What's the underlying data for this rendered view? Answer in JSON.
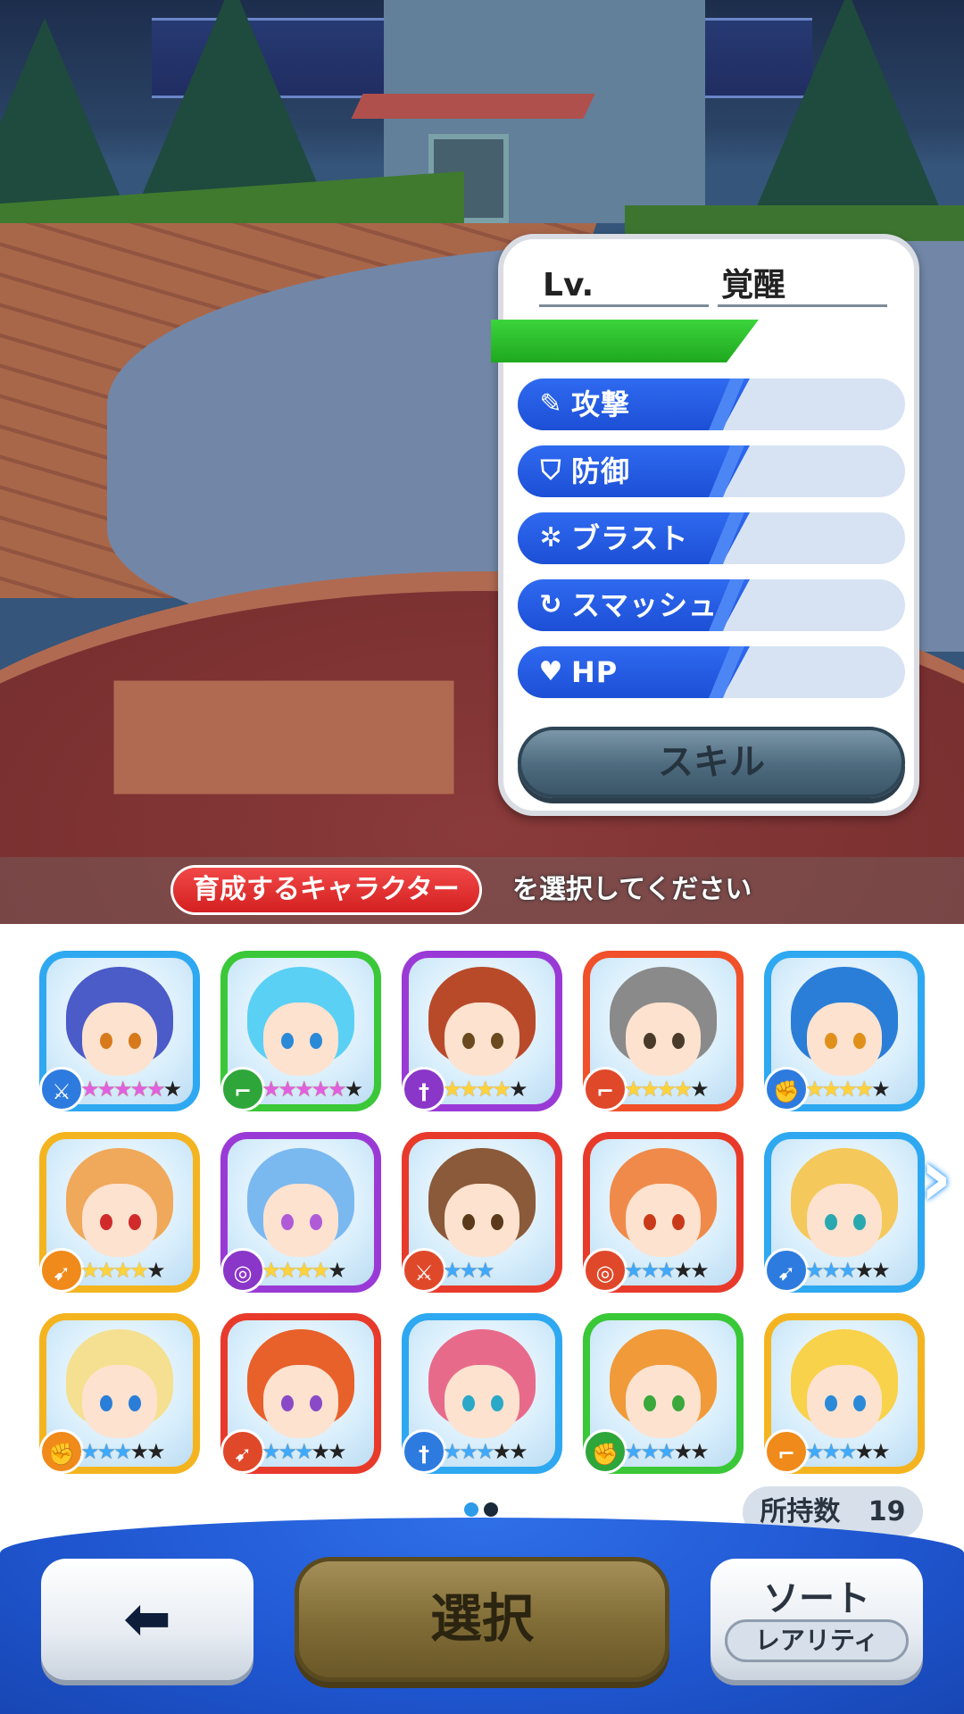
{
  "stats_panel": {
    "level_label": "Lv.",
    "awakening_label": "覚醒",
    "stats": [
      {
        "icon": "sword-icon",
        "glyph": "✎",
        "label": "攻撃"
      },
      {
        "icon": "shield-icon",
        "glyph": "⛉",
        "label": "防御"
      },
      {
        "icon": "burst-icon",
        "glyph": "✲",
        "label": "ブラスト"
      },
      {
        "icon": "smash-icon",
        "glyph": "↻",
        "label": "スマッシュ"
      },
      {
        "icon": "heart-icon",
        "glyph": "♥",
        "label": "HP"
      }
    ],
    "skill_button": "スキル"
  },
  "instruction": {
    "highlight": "育成するキャラクター",
    "text": "を選択してください"
  },
  "characters": [
    {
      "frame": "#2ea8f0",
      "hair": "#4b5bc8",
      "eye": "#d77a1c",
      "type_color": "#2e7be0",
      "type_icon": "sword-icon",
      "type_glyph": "⚔",
      "stars_on": 5,
      "stars_total": 6,
      "star_color": "pink"
    },
    {
      "frame": "#3ac838",
      "hair": "#5ad0f4",
      "eye": "#2a8ad8",
      "type_color": "#2fa63a",
      "type_icon": "gun-icon",
      "type_glyph": "⌐",
      "stars_on": 5,
      "stars_total": 6,
      "star_color": "pink"
    },
    {
      "frame": "#9a3ad6",
      "hair": "#b84a2a",
      "eye": "#6a4a1e",
      "type_color": "#8a36c8",
      "type_icon": "sword-icon",
      "type_glyph": "†",
      "stars_on": 4,
      "stars_total": 5,
      "star_color": "gold"
    },
    {
      "frame": "#f0502a",
      "hair": "#8a8a8a",
      "eye": "#4a3a2a",
      "type_color": "#e0482a",
      "type_icon": "gun-icon",
      "type_glyph": "⌐",
      "stars_on": 4,
      "stars_total": 5,
      "star_color": "gold"
    },
    {
      "frame": "#2ea8f0",
      "hair": "#2a7ed8",
      "eye": "#e0901a",
      "type_color": "#2e7be0",
      "type_icon": "fist-icon",
      "type_glyph": "✊",
      "stars_on": 4,
      "stars_total": 5,
      "star_color": "gold"
    },
    {
      "frame": "#f4b420",
      "hair": "#f0a85a",
      "eye": "#d02a2a",
      "type_color": "#f08a1a",
      "type_icon": "bow-icon",
      "type_glyph": "➹",
      "stars_on": 4,
      "stars_total": 5,
      "star_color": "gold"
    },
    {
      "frame": "#9a3ad6",
      "hair": "#7ab8f0",
      "eye": "#b05ad8",
      "type_color": "#8a36c8",
      "type_icon": "magic-icon",
      "type_glyph": "◎",
      "stars_on": 4,
      "stars_total": 5,
      "star_color": "gold"
    },
    {
      "frame": "#e83a2a",
      "hair": "#8a5a3a",
      "eye": "#5a3a1a",
      "type_color": "#e0482a",
      "type_icon": "sword-icon",
      "type_glyph": "⚔",
      "stars_on": 3,
      "stars_total": 3,
      "star_color": "blue"
    },
    {
      "frame": "#e83a2a",
      "hair": "#f08a4a",
      "eye": "#c83a1a",
      "type_color": "#e0482a",
      "type_icon": "magic-icon",
      "type_glyph": "◎",
      "stars_on": 3,
      "stars_total": 5,
      "star_color": "blue"
    },
    {
      "frame": "#2ea8f0",
      "hair": "#f4c85a",
      "eye": "#2aa8b0",
      "type_color": "#2e7be0",
      "type_icon": "bow-icon",
      "type_glyph": "➹",
      "stars_on": 3,
      "stars_total": 5,
      "star_color": "blue"
    },
    {
      "frame": "#f4b420",
      "hair": "#f4e090",
      "eye": "#2a7ed8",
      "type_color": "#f08a1a",
      "type_icon": "fist-icon",
      "type_glyph": "✊",
      "stars_on": 3,
      "stars_total": 5,
      "star_color": "blue"
    },
    {
      "frame": "#e83a2a",
      "hair": "#e8602a",
      "eye": "#8a4ac8",
      "type_color": "#e0482a",
      "type_icon": "bow-icon",
      "type_glyph": "➹",
      "stars_on": 3,
      "stars_total": 5,
      "star_color": "blue"
    },
    {
      "frame": "#2ea8f0",
      "hair": "#e86a8a",
      "eye": "#2aa8c8",
      "type_color": "#2e7be0",
      "type_icon": "sword-icon",
      "type_glyph": "†",
      "stars_on": 3,
      "stars_total": 5,
      "star_color": "blue"
    },
    {
      "frame": "#3ac838",
      "hair": "#f09a3a",
      "eye": "#3aa83a",
      "type_color": "#2fa63a",
      "type_icon": "fist-icon",
      "type_glyph": "✊",
      "stars_on": 3,
      "stars_total": 5,
      "star_color": "blue"
    },
    {
      "frame": "#f4b420",
      "hair": "#f8d24a",
      "eye": "#2a8ad8",
      "type_color": "#f08a1a",
      "type_icon": "gun-icon",
      "type_glyph": "⌐",
      "stars_on": 3,
      "stars_total": 5,
      "star_color": "blue"
    }
  ],
  "pagination": {
    "current": 1,
    "total": 2,
    "active_color": "#2e9be8",
    "inactive_color": "#1a2a3a"
  },
  "owned": {
    "label": "所持数",
    "count": "19"
  },
  "buttons": {
    "back_glyph": "⬅",
    "select": "選択",
    "sort": "ソート",
    "sort_mode": "レアリティ"
  }
}
